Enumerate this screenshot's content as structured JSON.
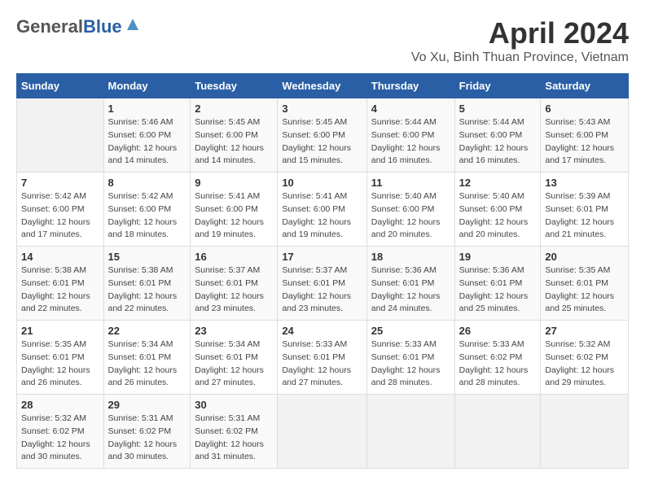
{
  "logo": {
    "general": "General",
    "blue": "Blue"
  },
  "title": "April 2024",
  "subtitle": "Vo Xu, Binh Thuan Province, Vietnam",
  "headers": [
    "Sunday",
    "Monday",
    "Tuesday",
    "Wednesday",
    "Thursday",
    "Friday",
    "Saturday"
  ],
  "weeks": [
    [
      {
        "day": "",
        "data": []
      },
      {
        "day": "1",
        "data": [
          "Sunrise: 5:46 AM",
          "Sunset: 6:00 PM",
          "Daylight: 12 hours",
          "and 14 minutes."
        ]
      },
      {
        "day": "2",
        "data": [
          "Sunrise: 5:45 AM",
          "Sunset: 6:00 PM",
          "Daylight: 12 hours",
          "and 14 minutes."
        ]
      },
      {
        "day": "3",
        "data": [
          "Sunrise: 5:45 AM",
          "Sunset: 6:00 PM",
          "Daylight: 12 hours",
          "and 15 minutes."
        ]
      },
      {
        "day": "4",
        "data": [
          "Sunrise: 5:44 AM",
          "Sunset: 6:00 PM",
          "Daylight: 12 hours",
          "and 16 minutes."
        ]
      },
      {
        "day": "5",
        "data": [
          "Sunrise: 5:44 AM",
          "Sunset: 6:00 PM",
          "Daylight: 12 hours",
          "and 16 minutes."
        ]
      },
      {
        "day": "6",
        "data": [
          "Sunrise: 5:43 AM",
          "Sunset: 6:00 PM",
          "Daylight: 12 hours",
          "and 17 minutes."
        ]
      }
    ],
    [
      {
        "day": "7",
        "data": [
          "Sunrise: 5:42 AM",
          "Sunset: 6:00 PM",
          "Daylight: 12 hours",
          "and 17 minutes."
        ]
      },
      {
        "day": "8",
        "data": [
          "Sunrise: 5:42 AM",
          "Sunset: 6:00 PM",
          "Daylight: 12 hours",
          "and 18 minutes."
        ]
      },
      {
        "day": "9",
        "data": [
          "Sunrise: 5:41 AM",
          "Sunset: 6:00 PM",
          "Daylight: 12 hours",
          "and 19 minutes."
        ]
      },
      {
        "day": "10",
        "data": [
          "Sunrise: 5:41 AM",
          "Sunset: 6:00 PM",
          "Daylight: 12 hours",
          "and 19 minutes."
        ]
      },
      {
        "day": "11",
        "data": [
          "Sunrise: 5:40 AM",
          "Sunset: 6:00 PM",
          "Daylight: 12 hours",
          "and 20 minutes."
        ]
      },
      {
        "day": "12",
        "data": [
          "Sunrise: 5:40 AM",
          "Sunset: 6:00 PM",
          "Daylight: 12 hours",
          "and 20 minutes."
        ]
      },
      {
        "day": "13",
        "data": [
          "Sunrise: 5:39 AM",
          "Sunset: 6:01 PM",
          "Daylight: 12 hours",
          "and 21 minutes."
        ]
      }
    ],
    [
      {
        "day": "14",
        "data": [
          "Sunrise: 5:38 AM",
          "Sunset: 6:01 PM",
          "Daylight: 12 hours",
          "and 22 minutes."
        ]
      },
      {
        "day": "15",
        "data": [
          "Sunrise: 5:38 AM",
          "Sunset: 6:01 PM",
          "Daylight: 12 hours",
          "and 22 minutes."
        ]
      },
      {
        "day": "16",
        "data": [
          "Sunrise: 5:37 AM",
          "Sunset: 6:01 PM",
          "Daylight: 12 hours",
          "and 23 minutes."
        ]
      },
      {
        "day": "17",
        "data": [
          "Sunrise: 5:37 AM",
          "Sunset: 6:01 PM",
          "Daylight: 12 hours",
          "and 23 minutes."
        ]
      },
      {
        "day": "18",
        "data": [
          "Sunrise: 5:36 AM",
          "Sunset: 6:01 PM",
          "Daylight: 12 hours",
          "and 24 minutes."
        ]
      },
      {
        "day": "19",
        "data": [
          "Sunrise: 5:36 AM",
          "Sunset: 6:01 PM",
          "Daylight: 12 hours",
          "and 25 minutes."
        ]
      },
      {
        "day": "20",
        "data": [
          "Sunrise: 5:35 AM",
          "Sunset: 6:01 PM",
          "Daylight: 12 hours",
          "and 25 minutes."
        ]
      }
    ],
    [
      {
        "day": "21",
        "data": [
          "Sunrise: 5:35 AM",
          "Sunset: 6:01 PM",
          "Daylight: 12 hours",
          "and 26 minutes."
        ]
      },
      {
        "day": "22",
        "data": [
          "Sunrise: 5:34 AM",
          "Sunset: 6:01 PM",
          "Daylight: 12 hours",
          "and 26 minutes."
        ]
      },
      {
        "day": "23",
        "data": [
          "Sunrise: 5:34 AM",
          "Sunset: 6:01 PM",
          "Daylight: 12 hours",
          "and 27 minutes."
        ]
      },
      {
        "day": "24",
        "data": [
          "Sunrise: 5:33 AM",
          "Sunset: 6:01 PM",
          "Daylight: 12 hours",
          "and 27 minutes."
        ]
      },
      {
        "day": "25",
        "data": [
          "Sunrise: 5:33 AM",
          "Sunset: 6:01 PM",
          "Daylight: 12 hours",
          "and 28 minutes."
        ]
      },
      {
        "day": "26",
        "data": [
          "Sunrise: 5:33 AM",
          "Sunset: 6:02 PM",
          "Daylight: 12 hours",
          "and 28 minutes."
        ]
      },
      {
        "day": "27",
        "data": [
          "Sunrise: 5:32 AM",
          "Sunset: 6:02 PM",
          "Daylight: 12 hours",
          "and 29 minutes."
        ]
      }
    ],
    [
      {
        "day": "28",
        "data": [
          "Sunrise: 5:32 AM",
          "Sunset: 6:02 PM",
          "Daylight: 12 hours",
          "and 30 minutes."
        ]
      },
      {
        "day": "29",
        "data": [
          "Sunrise: 5:31 AM",
          "Sunset: 6:02 PM",
          "Daylight: 12 hours",
          "and 30 minutes."
        ]
      },
      {
        "day": "30",
        "data": [
          "Sunrise: 5:31 AM",
          "Sunset: 6:02 PM",
          "Daylight: 12 hours",
          "and 31 minutes."
        ]
      },
      {
        "day": "",
        "data": []
      },
      {
        "day": "",
        "data": []
      },
      {
        "day": "",
        "data": []
      },
      {
        "day": "",
        "data": []
      }
    ]
  ]
}
